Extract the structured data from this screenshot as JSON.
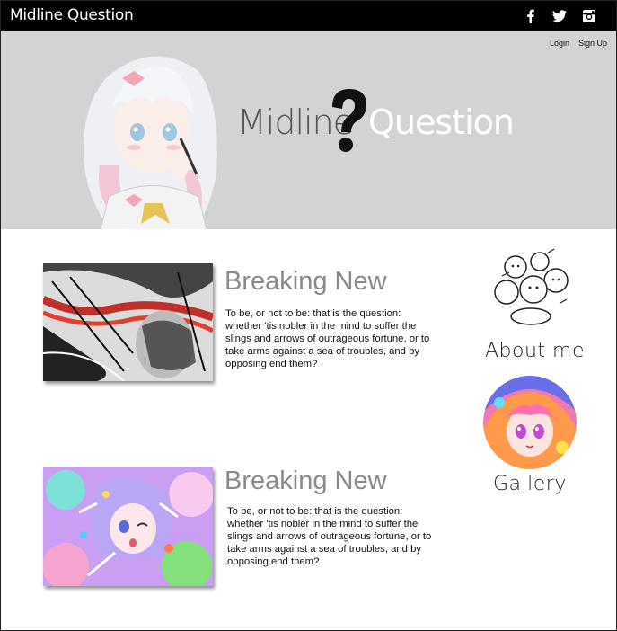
{
  "topbar": {
    "brand": "Midline Question",
    "social_icons": [
      "facebook-icon",
      "twitter-icon",
      "instagram-icon"
    ]
  },
  "hero": {
    "login_label": "Login",
    "signup_label": "Sign Up",
    "logo_left": "Midline",
    "logo_right": "Question"
  },
  "articles": [
    {
      "title": "Breaking New",
      "body": "To be, or not to be: that is the question: whether 'tis nobler in the mind to suffer the slings and arrows of outrageous fortune, or to take arms against a sea of troubles, and by opposing end them?"
    },
    {
      "title": "Breaking New",
      "body": "To be, or not to be: that is the question: whether 'tis nobler in the mind to suffer the slings and arrows of outrageous fortune, or to take arms against a sea of troubles, and by opposing end them?"
    }
  ],
  "sidebar": {
    "about_label": "About me",
    "gallery_label": "Gallery"
  },
  "colors": {
    "topbar": "#000000",
    "hero_bg": "#d3d3d3",
    "title_gray": "#8a8a8a"
  }
}
